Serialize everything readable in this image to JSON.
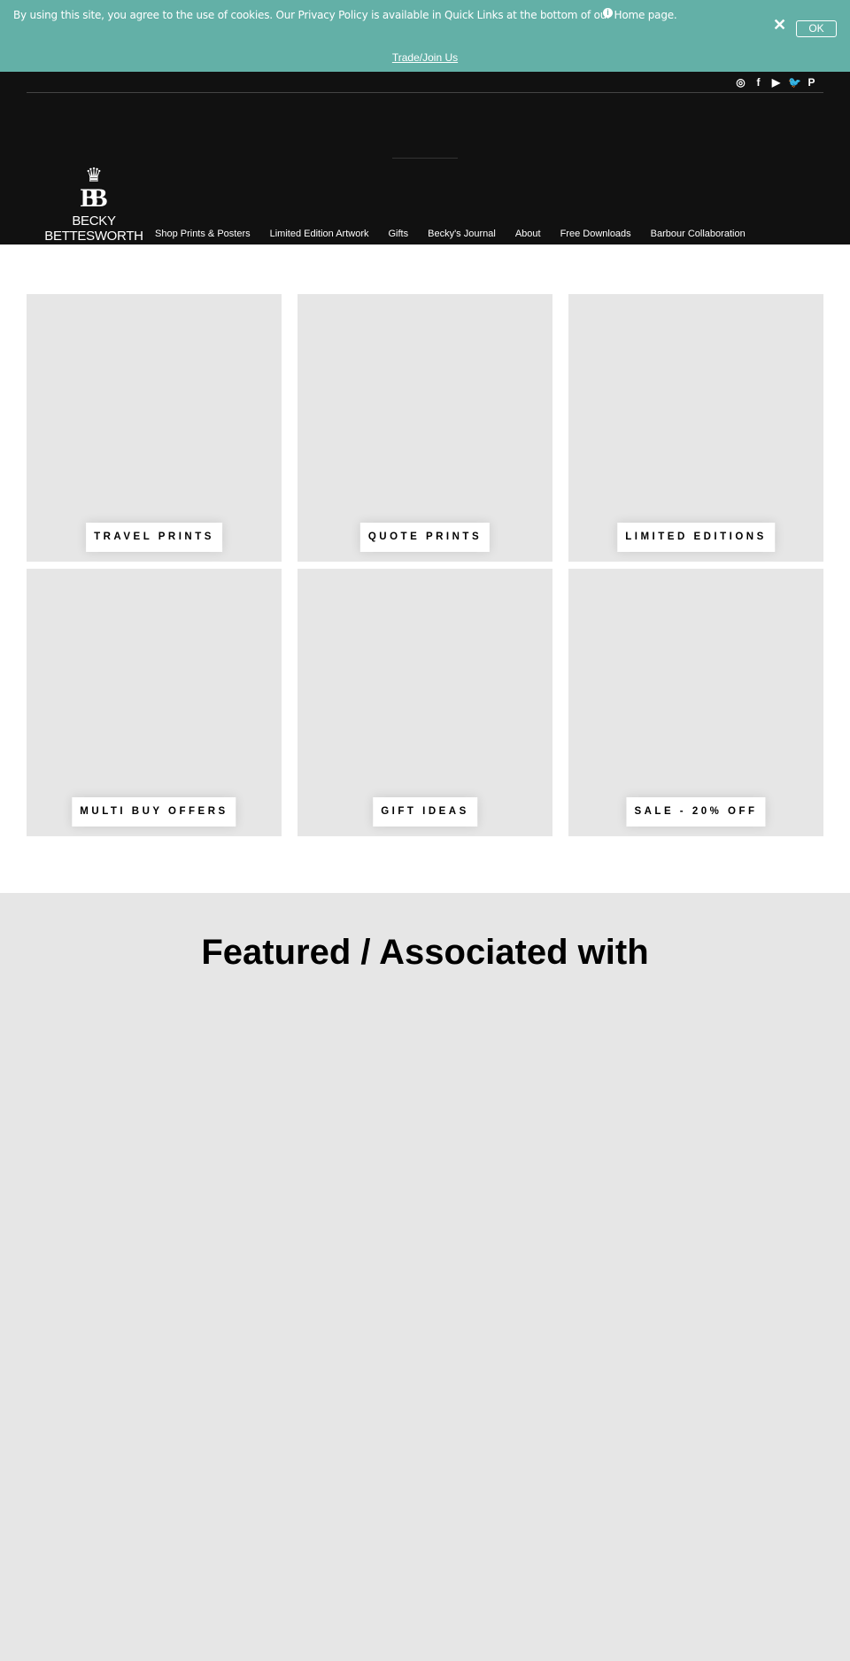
{
  "cookie_banner": {
    "message": "By using this site, you agree to the use of cookies. Our Privacy Policy is available in Quick Links at the bottom of our Home page.",
    "info_icon": "i",
    "close_label": "✕",
    "ok_label": "OK",
    "trade_link": "Trade/Join Us",
    "color": "#63b0a7"
  },
  "header": {
    "social": [
      {
        "icon": "instagram-icon",
        "glyph": "◎"
      },
      {
        "icon": "facebook-icon",
        "glyph": "f"
      },
      {
        "icon": "youtube-icon",
        "glyph": "▶"
      },
      {
        "icon": "twitter-icon",
        "glyph": "🐦"
      },
      {
        "icon": "pinterest-icon",
        "glyph": "P"
      }
    ],
    "logo": {
      "crown": "♛",
      "monogram": "BB",
      "name": "BECKY BETTESWORTH"
    },
    "nav": [
      "Shop Prints & Posters",
      "Limited Edition Artwork",
      "Gifts",
      "Becky's Journal",
      "About",
      "Free Downloads",
      "Barbour Collaboration"
    ]
  },
  "tiles": [
    "TRAVEL PRINTS",
    "QUOTE PRINTS",
    "LIMITED EDITIONS",
    "MULTI BUY OFFERS",
    "GIFT IDEAS",
    "SALE - 20% OFF"
  ],
  "featured": {
    "title": "Featured / Associated with"
  }
}
